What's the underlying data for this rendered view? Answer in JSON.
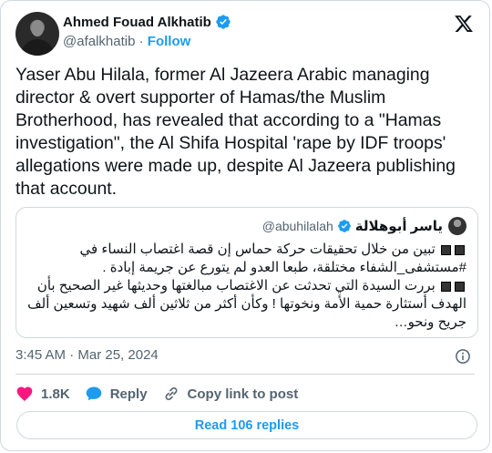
{
  "author": {
    "name": "Ahmed Fouad Alkhatib",
    "handle": "@afalkhatib",
    "separator": "·",
    "follow_label": "Follow"
  },
  "tweet": {
    "text": "Yaser Abu Hilala, former Al Jazeera Arabic managing director & overt supporter of Hamas/the Muslim Brotherhood, has revealed that according to a \"Hamas investigation\", the Al Shifa Hospital 'rape by IDF troops' allegations were made up, despite Al Jazeera publishing that account."
  },
  "quote": {
    "name": "ياسر أبوهلالة",
    "handle": "@abuhilalah",
    "line1": "تبين من خلال تحقيقات حركة حماس إن قصة اغتصاب النساء في #مستشفى_الشفاء مختلقة، طبعا العدو لم يتورع عن جريمة إبادة .",
    "line2": "بررت السيدة التي تحدثت عن الاغتصاب مبالغتها وحديثها غير الصحيح بأن الهدف أستثارة حمية الأمة ونخوتها ! وكأن أكثر من ثلاثين ألف شهيد وتسعين ألف جريح ونحو…"
  },
  "meta": {
    "time": "3:45 AM · Mar 25, 2024"
  },
  "actions": {
    "likes": "1.8K",
    "reply_label": "Reply",
    "copy_label": "Copy link to post"
  },
  "read_replies": "Read 106 replies",
  "colors": {
    "accent": "#1d9bf0",
    "like": "#f91880",
    "muted": "#536471",
    "border": "#cfd9de"
  },
  "icons": [
    "verified-badge-icon",
    "x-logo-icon",
    "info-icon",
    "heart-icon",
    "reply-bubble-icon",
    "link-icon"
  ]
}
